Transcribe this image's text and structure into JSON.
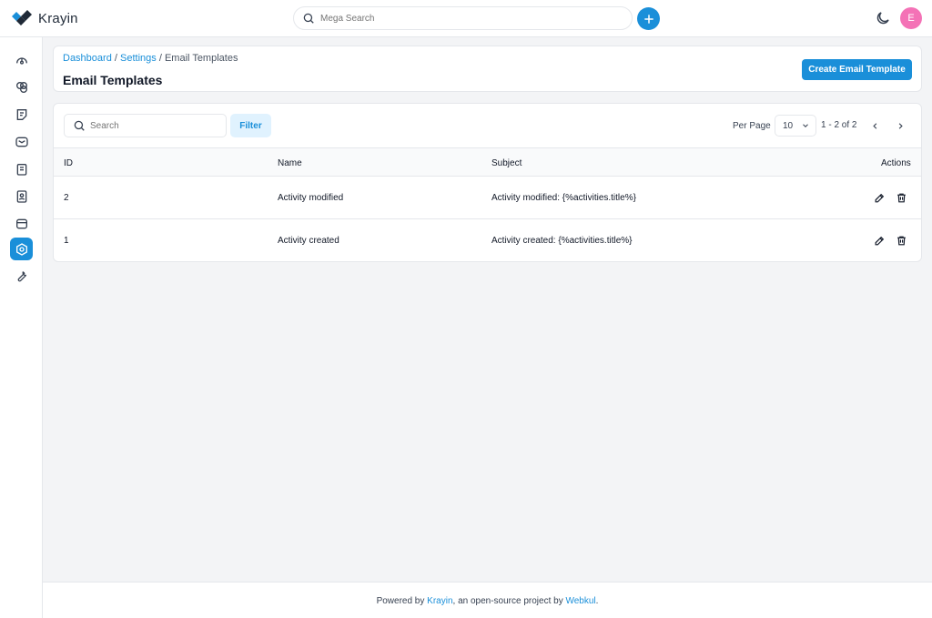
{
  "app": {
    "name": "Krayin"
  },
  "header": {
    "search_placeholder": "Mega Search",
    "avatar_initial": "E"
  },
  "sidebar": {
    "items": [
      {
        "name": "dashboard",
        "icon": "gauge-icon",
        "active": false
      },
      {
        "name": "leads",
        "icon": "filter-icon",
        "active": false
      },
      {
        "name": "quotes",
        "icon": "note-icon",
        "active": false
      },
      {
        "name": "mail",
        "icon": "mail-icon",
        "active": false
      },
      {
        "name": "activities",
        "icon": "clipboard-icon",
        "active": false
      },
      {
        "name": "contacts",
        "icon": "contact-icon",
        "active": false
      },
      {
        "name": "products",
        "icon": "box-icon",
        "active": false
      },
      {
        "name": "settings",
        "icon": "gear-icon",
        "active": true
      },
      {
        "name": "configuration",
        "icon": "wrench-icon",
        "active": false
      }
    ]
  },
  "breadcrumb": {
    "items": [
      "Dashboard",
      "Settings",
      "Email Templates"
    ],
    "separator": "/"
  },
  "page": {
    "title": "Email Templates",
    "create_button": "Create Email Template"
  },
  "toolbar": {
    "search_placeholder": "Search",
    "filter_label": "Filter",
    "per_page_label": "Per Page",
    "per_page_value": "10",
    "page_info": "1 - 2 of 2"
  },
  "table": {
    "columns": [
      "ID",
      "Name",
      "Subject",
      "Actions"
    ],
    "rows": [
      {
        "id": "2",
        "name": "Activity modified",
        "subject": "Activity modified: {%activities.title%}"
      },
      {
        "id": "1",
        "name": "Activity created",
        "subject": "Activity created: {%activities.title%}"
      }
    ]
  },
  "footer": {
    "prefix": "Powered by ",
    "brand": "Krayin",
    "middle": ", an open-source project by ",
    "company": "Webkul",
    "suffix": "."
  },
  "colors": {
    "accent": "#1a8fd9",
    "avatar": "#f472b6",
    "filter_bg": "#e0f2fe",
    "page_bg": "#f3f4f6"
  }
}
